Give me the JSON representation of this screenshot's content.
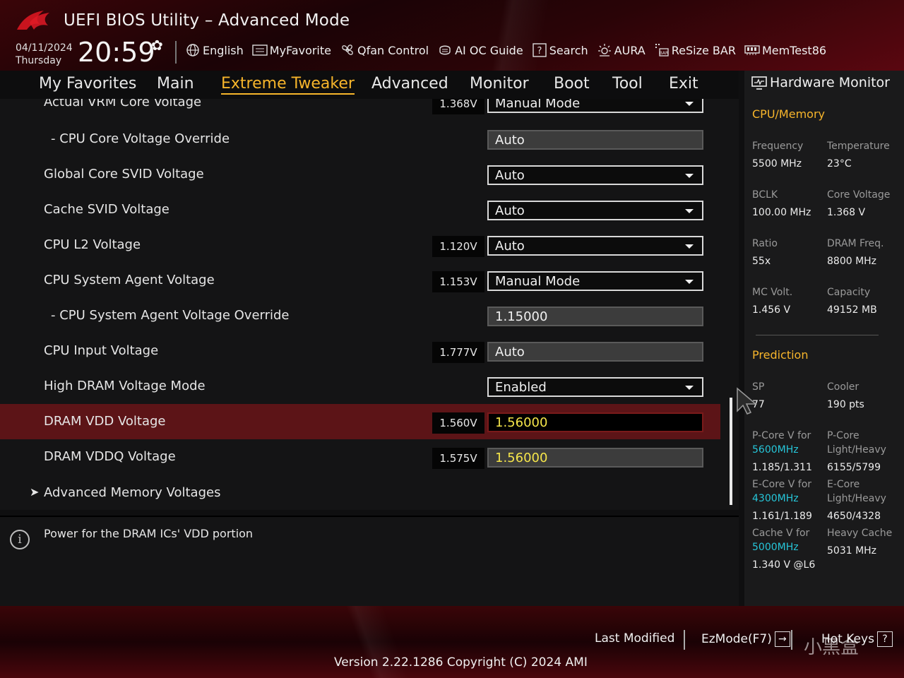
{
  "header": {
    "title": "UEFI BIOS Utility – Advanced Mode",
    "date": "04/11/2024",
    "day": "Thursday",
    "time": "20:59",
    "toolbar": [
      {
        "label": "English",
        "icon": "globe-icon"
      },
      {
        "label": "MyFavorite",
        "icon": "favorite-icon"
      },
      {
        "label": "Qfan Control",
        "icon": "fan-icon"
      },
      {
        "label": "AI OC Guide",
        "icon": "ai-guide-icon"
      },
      {
        "label": "Search",
        "icon": "search-icon"
      },
      {
        "label": "AURA",
        "icon": "aura-icon"
      },
      {
        "label": "ReSize BAR",
        "icon": "resize-bar-icon"
      },
      {
        "label": "MemTest86",
        "icon": "memtest-icon"
      }
    ]
  },
  "nav": {
    "tabs": [
      "My Favorites",
      "Main",
      "Extreme Tweaker",
      "Advanced",
      "Monitor",
      "Boot",
      "Tool",
      "Exit"
    ],
    "active": "Extreme Tweaker"
  },
  "settings": [
    {
      "label": "Actual VRM Core Voltage",
      "readout": "1.368V",
      "value": "Manual Mode",
      "kind": "select"
    },
    {
      "label": "- CPU Core Voltage Override",
      "readout": "",
      "value": "Auto",
      "kind": "readonly",
      "indent": true
    },
    {
      "label": "Global Core SVID Voltage",
      "readout": "",
      "value": "Auto",
      "kind": "select"
    },
    {
      "label": "Cache SVID Voltage",
      "readout": "",
      "value": "Auto",
      "kind": "select"
    },
    {
      "label": "CPU L2 Voltage",
      "readout": "1.120V",
      "value": "Auto",
      "kind": "select"
    },
    {
      "label": "CPU System Agent Voltage",
      "readout": "1.153V",
      "value": "Manual Mode",
      "kind": "select"
    },
    {
      "label": "- CPU System Agent Voltage Override",
      "readout": "",
      "value": "1.15000",
      "kind": "readonly",
      "indent": true
    },
    {
      "label": "CPU Input Voltage",
      "readout": "1.777V",
      "value": "Auto",
      "kind": "readonly"
    },
    {
      "label": "High DRAM Voltage Mode",
      "readout": "",
      "value": "Enabled",
      "kind": "select"
    },
    {
      "label": "DRAM VDD Voltage",
      "readout": "1.560V",
      "value": "1.56000",
      "kind": "editing",
      "selected": true
    },
    {
      "label": "DRAM VDDQ Voltage",
      "readout": "1.575V",
      "value": "1.56000",
      "kind": "readonly-yellow"
    },
    {
      "label": "Advanced Memory Voltages",
      "readout": "",
      "value": "",
      "kind": "submenu"
    }
  ],
  "help": {
    "text": "Power for the DRAM ICs' VDD portion"
  },
  "hwmon": {
    "title": "Hardware Monitor",
    "cpu_memory_title": "CPU/Memory",
    "frequency_label": "Frequency",
    "frequency_value": "5500 MHz",
    "temperature_label": "Temperature",
    "temperature_value": "23°C",
    "bclk_label": "BCLK",
    "bclk_value": "100.00 MHz",
    "core_voltage_label": "Core Voltage",
    "core_voltage_value": "1.368 V",
    "ratio_label": "Ratio",
    "ratio_value": "55x",
    "dram_freq_label": "DRAM Freq.",
    "dram_freq_value": "8800 MHz",
    "mc_volt_label": "MC Volt.",
    "mc_volt_value": "1.456 V",
    "capacity_label": "Capacity",
    "capacity_value": "49152 MB",
    "prediction_title": "Prediction",
    "sp_label": "SP",
    "sp_value": "77",
    "cooler_label": "Cooler",
    "cooler_value": "190 pts",
    "pcore_v_label": "P-Core V for",
    "pcore_v_freq": "5600MHz",
    "pcore_v_value": "1.185/1.311",
    "pcore_lh_label1": "P-Core",
    "pcore_lh_label2": "Light/Heavy",
    "pcore_lh_value": "6155/5799",
    "ecore_v_label": "E-Core V for",
    "ecore_v_freq": "4300MHz",
    "ecore_v_value": "1.161/1.189",
    "ecore_lh_label1": "E-Core",
    "ecore_lh_label2": "Light/Heavy",
    "ecore_lh_value": "4650/4328",
    "cache_v_label": "Cache V for",
    "cache_v_freq": "5000MHz",
    "cache_v_value": "1.340 V @L6",
    "heavy_cache_label": "Heavy Cache",
    "heavy_cache_value": "5031 MHz"
  },
  "footer": {
    "last_modified": "Last Modified",
    "ezmode": "EzMode(F7)",
    "ezmode_key": "→",
    "hotkeys": "Hot Keys",
    "hotkeys_key": "?",
    "version": "Version 2.22.1286 Copyright (C) 2024 AMI",
    "watermark": "小黑盒"
  },
  "colors": {
    "accent": "#f7b52b",
    "selected_row": "#5c1417",
    "edit_text": "#f5e54a",
    "freq_cyan": "#26c6d9"
  }
}
